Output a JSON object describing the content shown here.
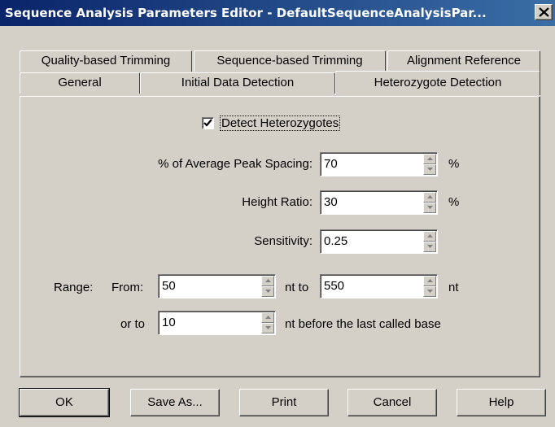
{
  "window": {
    "title": "Sequence Analysis Parameters Editor - DefaultSequenceAnalysisPar...",
    "close_glyph": "close-icon"
  },
  "tabs_back_row": [
    "Quality-based Trimming",
    "Sequence-based Trimming",
    "Alignment Reference"
  ],
  "tabs_front_row": [
    "General",
    "Initial Data Detection",
    "Heterozygote Detection"
  ],
  "active_tab": "Heterozygote Detection",
  "detect": {
    "checked": true,
    "label": "Detect Heterozygotes"
  },
  "fields": {
    "peak_spacing": {
      "label": "% of Average Peak Spacing:",
      "value": "70",
      "unit": "%"
    },
    "height_ratio": {
      "label": "Height Ratio:",
      "value": "30",
      "unit": "%"
    },
    "sensitivity": {
      "label": "Sensitivity:",
      "value": "0.25"
    }
  },
  "range": {
    "label": "Range:",
    "from_label": "From:",
    "from_value": "50",
    "to_label": "nt to",
    "to_value": "550",
    "to_unit": "nt",
    "or_label": "or to",
    "or_value": "10",
    "or_suffix": "nt before the last called base"
  },
  "buttons": {
    "ok": "OK",
    "save_as": "Save As...",
    "print": "Print",
    "cancel": "Cancel",
    "help": "Help"
  }
}
